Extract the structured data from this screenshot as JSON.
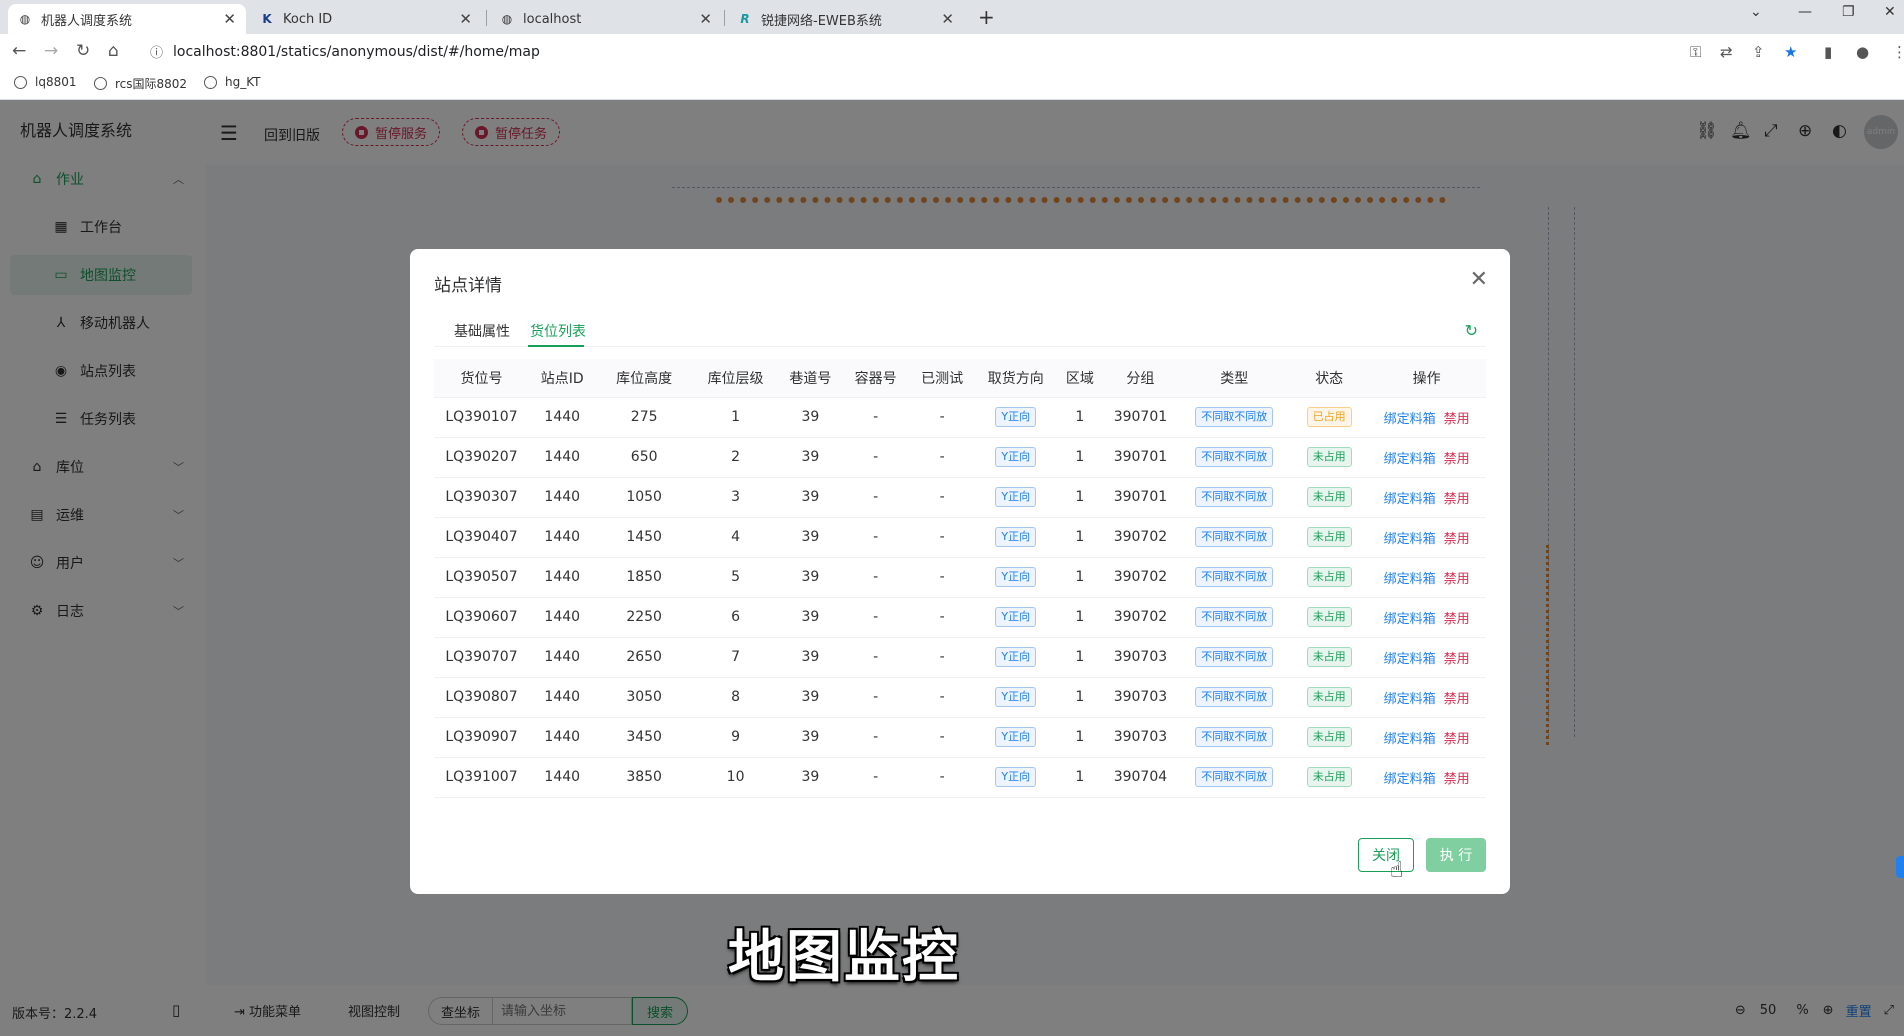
{
  "browser": {
    "tabs": [
      {
        "title": "机器人调度系统",
        "active": true
      },
      {
        "title": "Koch ID",
        "active": false
      },
      {
        "title": "localhost",
        "active": false
      },
      {
        "title": "锐捷网络-EWEB系统",
        "active": false
      }
    ],
    "url": "localhost:8801/statics/anonymous/dist/#/home/map",
    "bookmarks": [
      "lq8801",
      "rcs国际8802",
      "hg_KT"
    ]
  },
  "sidebar": {
    "title": "机器人调度系统",
    "items": [
      {
        "label": "作业",
        "icon": "home-icon",
        "expanded": true
      },
      {
        "label": "工作台",
        "icon": "grid-icon"
      },
      {
        "label": "地图监控",
        "icon": "monitor-icon",
        "active": true
      },
      {
        "label": "移动机器人",
        "icon": "robot-icon"
      },
      {
        "label": "站点列表",
        "icon": "target-icon"
      },
      {
        "label": "任务列表",
        "icon": "list-icon"
      },
      {
        "label": "库位",
        "icon": "home-icon"
      },
      {
        "label": "运维",
        "icon": "chart-icon"
      },
      {
        "label": "用户",
        "icon": "user-icon"
      },
      {
        "label": "日志",
        "icon": "gear-icon"
      }
    ],
    "version": "版本号：2.2.4"
  },
  "topbar": {
    "back_label": "回到旧版",
    "pause_service": "暂停服务",
    "pause_task": "暂停任务",
    "avatar_text": "admin"
  },
  "bottombar": {
    "func_menu": "功能菜单",
    "view_control": "视图控制",
    "coord_label": "查坐标",
    "coord_placeholder": "请输入坐标",
    "search": "搜索",
    "zoom_value": "50",
    "zoom_unit": "%",
    "reset": "重置"
  },
  "modal": {
    "title": "站点详情",
    "tabs": [
      "基础属性",
      "货位列表"
    ],
    "active_tab": "货位列表",
    "columns": [
      "货位号",
      "站点ID",
      "库位高度",
      "库位层级",
      "巷道号",
      "容器号",
      "已测试",
      "取货方向",
      "区域",
      "分组",
      "类型",
      "状态",
      "操作"
    ],
    "rows": [
      {
        "loc": "LQ390107",
        "site": "1440",
        "height": "275",
        "level": "1",
        "aisle": "39",
        "container": "-",
        "tested": "-",
        "dir": "Y正向",
        "area": "1",
        "group": "390701",
        "type": "不同取不同放",
        "status": "已占用",
        "status_kind": "occ"
      },
      {
        "loc": "LQ390207",
        "site": "1440",
        "height": "650",
        "level": "2",
        "aisle": "39",
        "container": "-",
        "tested": "-",
        "dir": "Y正向",
        "area": "1",
        "group": "390701",
        "type": "不同取不同放",
        "status": "未占用",
        "status_kind": "free"
      },
      {
        "loc": "LQ390307",
        "site": "1440",
        "height": "1050",
        "level": "3",
        "aisle": "39",
        "container": "-",
        "tested": "-",
        "dir": "Y正向",
        "area": "1",
        "group": "390701",
        "type": "不同取不同放",
        "status": "未占用",
        "status_kind": "free"
      },
      {
        "loc": "LQ390407",
        "site": "1440",
        "height": "1450",
        "level": "4",
        "aisle": "39",
        "container": "-",
        "tested": "-",
        "dir": "Y正向",
        "area": "1",
        "group": "390702",
        "type": "不同取不同放",
        "status": "未占用",
        "status_kind": "free"
      },
      {
        "loc": "LQ390507",
        "site": "1440",
        "height": "1850",
        "level": "5",
        "aisle": "39",
        "container": "-",
        "tested": "-",
        "dir": "Y正向",
        "area": "1",
        "group": "390702",
        "type": "不同取不同放",
        "status": "未占用",
        "status_kind": "free"
      },
      {
        "loc": "LQ390607",
        "site": "1440",
        "height": "2250",
        "level": "6",
        "aisle": "39",
        "container": "-",
        "tested": "-",
        "dir": "Y正向",
        "area": "1",
        "group": "390702",
        "type": "不同取不同放",
        "status": "未占用",
        "status_kind": "free"
      },
      {
        "loc": "LQ390707",
        "site": "1440",
        "height": "2650",
        "level": "7",
        "aisle": "39",
        "container": "-",
        "tested": "-",
        "dir": "Y正向",
        "area": "1",
        "group": "390703",
        "type": "不同取不同放",
        "status": "未占用",
        "status_kind": "free"
      },
      {
        "loc": "LQ390807",
        "site": "1440",
        "height": "3050",
        "level": "8",
        "aisle": "39",
        "container": "-",
        "tested": "-",
        "dir": "Y正向",
        "area": "1",
        "group": "390703",
        "type": "不同取不同放",
        "status": "未占用",
        "status_kind": "free"
      },
      {
        "loc": "LQ390907",
        "site": "1440",
        "height": "3450",
        "level": "9",
        "aisle": "39",
        "container": "-",
        "tested": "-",
        "dir": "Y正向",
        "area": "1",
        "group": "390703",
        "type": "不同取不同放",
        "status": "未占用",
        "status_kind": "free"
      },
      {
        "loc": "LQ391007",
        "site": "1440",
        "height": "3850",
        "level": "10",
        "aisle": "39",
        "container": "-",
        "tested": "-",
        "dir": "Y正向",
        "area": "1",
        "group": "390704",
        "type": "不同取不同放",
        "status": "未占用",
        "status_kind": "free"
      }
    ],
    "op_bind": "绑定料箱",
    "op_disable": "禁用",
    "close_label": "关闭",
    "execute_label": "执 行"
  },
  "caption": "地图监控",
  "colors": {
    "accent": "#18a058",
    "danger": "#d03050",
    "link": "#2080f0",
    "warning": "#f0a020"
  }
}
